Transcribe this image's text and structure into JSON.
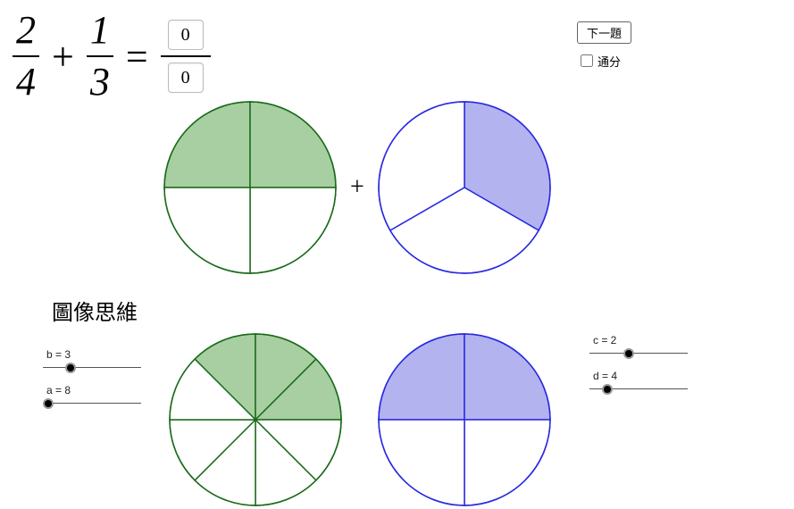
{
  "equation": {
    "left": {
      "num": "2",
      "den": "4"
    },
    "right": {
      "num": "1",
      "den": "3"
    },
    "op": "+",
    "eq": "=",
    "answer_num": "0",
    "answer_den": "0"
  },
  "buttons": {
    "next": "下一題"
  },
  "checkbox": {
    "label": "通分"
  },
  "pies": {
    "plus": "+",
    "pie1": {
      "slices": 4,
      "shaded": 2,
      "color_stroke": "#1b6b1b",
      "color_fill": "#a7cfa1"
    },
    "pie2": {
      "slices": 3,
      "shaded": 1,
      "color_stroke": "#2a2ae0",
      "color_fill": "#b3b3f0"
    }
  },
  "heading2": "圖像思維",
  "bottom": {
    "pie3": {
      "slices": 8,
      "shaded": 3,
      "color_stroke": "#1b6b1b",
      "color_fill": "#a7cfa1"
    },
    "pie4": {
      "slices": 4,
      "shaded": 2,
      "color_stroke": "#2a2ae0",
      "color_fill": "#b3b3f0"
    },
    "slider_b": {
      "label": "b = 3",
      "pos": 0.28
    },
    "slider_a": {
      "label": "a = 8",
      "pos": 0.05
    },
    "slider_c": {
      "label": "c = 2",
      "pos": 0.4
    },
    "slider_d": {
      "label": "d = 4",
      "pos": 0.18
    }
  },
  "chart_data": [
    {
      "type": "pie",
      "title": "2/4",
      "categories": [
        "shaded",
        "unshaded"
      ],
      "values": [
        2,
        2
      ],
      "total_slices": 4
    },
    {
      "type": "pie",
      "title": "1/3",
      "categories": [
        "shaded",
        "unshaded"
      ],
      "values": [
        1,
        2
      ],
      "total_slices": 3
    },
    {
      "type": "pie",
      "title": "3/8",
      "categories": [
        "shaded",
        "unshaded"
      ],
      "values": [
        3,
        5
      ],
      "total_slices": 8
    },
    {
      "type": "pie",
      "title": "2/4",
      "categories": [
        "shaded",
        "unshaded"
      ],
      "values": [
        2,
        2
      ],
      "total_slices": 4
    }
  ]
}
